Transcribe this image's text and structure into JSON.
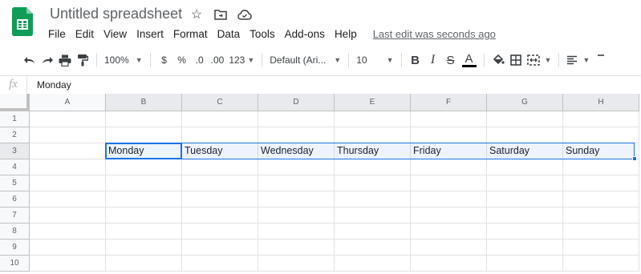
{
  "title": "Untitled spreadsheet",
  "menu": [
    "File",
    "Edit",
    "View",
    "Insert",
    "Format",
    "Data",
    "Tools",
    "Add-ons",
    "Help"
  ],
  "last_edit": "Last edit was seconds ago",
  "toolbar": {
    "zoom": "100%",
    "currency": "$",
    "percent": "%",
    "dec_decrease": ".0",
    "dec_increase": ".00",
    "more_formats": "123",
    "font": "Default (Ari...",
    "font_size": "10",
    "bold": "B",
    "italic": "I",
    "strike": "S",
    "text_color": "A"
  },
  "formula_bar": {
    "fx": "fx",
    "value": "Monday"
  },
  "columns": [
    "A",
    "B",
    "C",
    "D",
    "E",
    "F",
    "G",
    "H"
  ],
  "rows": [
    "1",
    "2",
    "3",
    "4",
    "5",
    "6",
    "7",
    "8",
    "9",
    "10"
  ],
  "cells": {
    "row3": [
      "",
      "Monday",
      "Tuesday",
      "Wednesday",
      "Thursday",
      "Friday",
      "Saturday",
      "Sunday"
    ]
  },
  "colors": {
    "accent": "#1a73e8",
    "sheets_green": "#0f9d58"
  }
}
